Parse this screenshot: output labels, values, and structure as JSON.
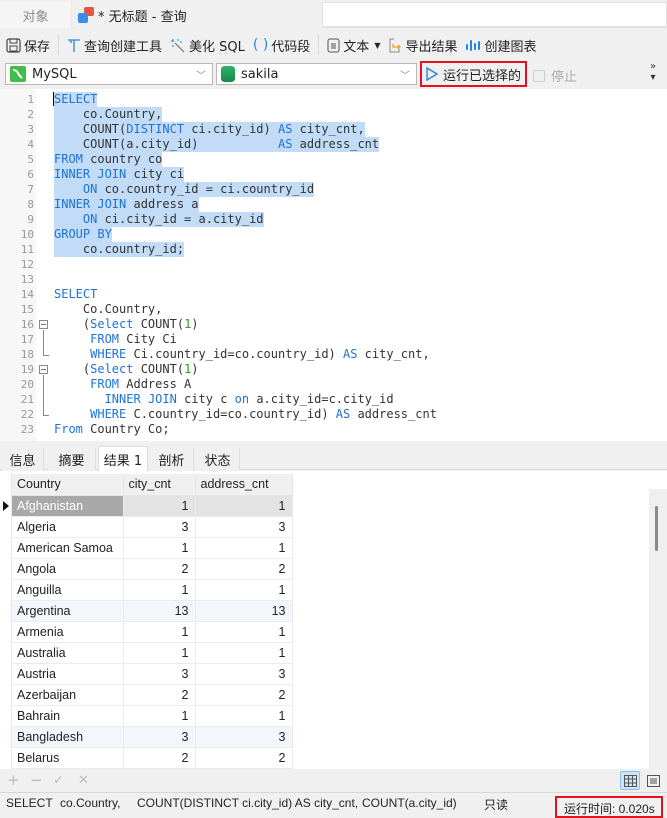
{
  "tabs": {
    "objects": "对象",
    "query": "* 无标题 - 查询"
  },
  "toolbar": {
    "save": "保存",
    "query_builder": "查询创建工具",
    "beautify": "美化 SQL",
    "snippet": "代码段",
    "text": "文本",
    "export": "导出结果",
    "chart": "创建图表"
  },
  "connection": {
    "value": "MySQL"
  },
  "database": {
    "value": "sakila"
  },
  "run_selected": "运行已选择的",
  "stop": "停止",
  "editor": {
    "lines": [
      {
        "n": "1",
        "code": "SELECT"
      },
      {
        "n": "2",
        "code": "    co.Country,"
      },
      {
        "n": "3",
        "code": "    COUNT(DISTINCT ci.city_id) AS city_cnt,"
      },
      {
        "n": "4",
        "code": "    COUNT(a.city_id)           AS address_cnt"
      },
      {
        "n": "5",
        "code": "FROM country co"
      },
      {
        "n": "6",
        "code": "INNER JOIN city ci"
      },
      {
        "n": "7",
        "code": "    ON co.country_id = ci.country_id"
      },
      {
        "n": "8",
        "code": "INNER JOIN address a"
      },
      {
        "n": "9",
        "code": "    ON ci.city_id = a.city_id"
      },
      {
        "n": "10",
        "code": "GROUP BY"
      },
      {
        "n": "11",
        "code": "    co.country_id;"
      },
      {
        "n": "12",
        "code": ""
      },
      {
        "n": "13",
        "code": ""
      },
      {
        "n": "14",
        "code": "SELECT"
      },
      {
        "n": "15",
        "code": "    Co.Country,"
      },
      {
        "n": "16",
        "code": "    (Select COUNT(1)"
      },
      {
        "n": "17",
        "code": "     FROM City Ci"
      },
      {
        "n": "18",
        "code": "     WHERE Ci.country_id=co.country_id) AS city_cnt,"
      },
      {
        "n": "19",
        "code": "    (Select COUNT(1)"
      },
      {
        "n": "20",
        "code": "     FROM Address A"
      },
      {
        "n": "21",
        "code": "       INNER JOIN city c on a.city_id=c.city_id"
      },
      {
        "n": "22",
        "code": "     WHERE C.country_id=co.country_id) AS address_cnt"
      },
      {
        "n": "23",
        "code": "From Country Co;"
      }
    ]
  },
  "result_tabs": [
    "信息",
    "摘要",
    "结果 1",
    "剖析",
    "状态"
  ],
  "result": {
    "columns": [
      "Country",
      "city_cnt",
      "address_cnt"
    ],
    "rows": [
      [
        "Afghanistan",
        "1",
        "1"
      ],
      [
        "Algeria",
        "3",
        "3"
      ],
      [
        "American Samoa",
        "1",
        "1"
      ],
      [
        "Angola",
        "2",
        "2"
      ],
      [
        "Anguilla",
        "1",
        "1"
      ],
      [
        "Argentina",
        "13",
        "13"
      ],
      [
        "Armenia",
        "1",
        "1"
      ],
      [
        "Australia",
        "1",
        "1"
      ],
      [
        "Austria",
        "3",
        "3"
      ],
      [
        "Azerbaijan",
        "2",
        "2"
      ],
      [
        "Bahrain",
        "1",
        "1"
      ],
      [
        "Bangladesh",
        "3",
        "3"
      ],
      [
        "Belarus",
        "2",
        "2"
      ]
    ]
  },
  "status": {
    "s1": "SELECT",
    "s2": "co.Country,",
    "s3": "COUNT(DISTINCT ci.city_id) AS city_cnt,",
    "s4": "COUNT(a.city_id)",
    "readonly": "只读",
    "runtime": "运行时间: 0.020s"
  },
  "colors": {
    "highlight_border": "#e3121c",
    "keyword": "#1e73d6",
    "selection": "#c2dcf7"
  }
}
